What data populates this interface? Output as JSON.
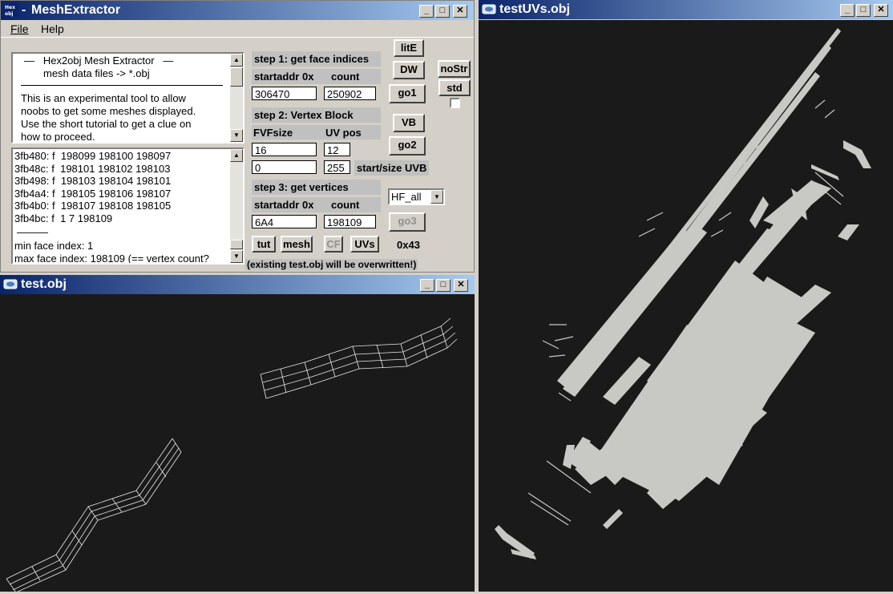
{
  "main_window": {
    "title": "MeshExtractor",
    "icon_text": "Hex\nobj -",
    "menu": [
      "File",
      "Help"
    ],
    "info_lines": [
      "—   Hex2obj Mesh Extractor   —",
      "mesh data files -> *.obj",
      "This is an experimental tool to allow",
      "noobs to get some meshes displayed.",
      "Use the short tutorial to get a clue on",
      "how to proceed."
    ],
    "log_lines": [
      "3fb480: f  198099 198100 198097",
      "3fb48c: f  198101 198102 198103",
      "3fb498: f  198103 198104 198101",
      "3fb4a4: f  198105 198106 198107",
      "3fb4b0: f  198107 198108 198105",
      "3fb4bc: f  1 7 198109",
      "———",
      "min face index: 1",
      "max face index: 198109 (== vertex count?"
    ],
    "step1": {
      "label": "step 1: get face indices",
      "startaddr_label": "startaddr 0x",
      "count_label": "count",
      "startaddr": "306470",
      "count": "250902"
    },
    "step2": {
      "label": "step 2: Vertex Block",
      "fvf_label": "FVFsize",
      "uvpos_label": "UV pos",
      "fvfsize": "16",
      "uvpos": "12",
      "uvb_start": "0",
      "uvb_size": "255",
      "uvb_label": "start/size UVB"
    },
    "step3": {
      "label": "step 3: get vertices",
      "startaddr_label": "startaddr 0x",
      "count_label": "count",
      "startaddr": "6A4",
      "count": "198109"
    },
    "buttons": {
      "lite": "litE",
      "dw": "DW",
      "go1": "go1",
      "vb": "VB",
      "go2": "go2",
      "go3": "go3",
      "nostr": "noStr",
      "std": "std",
      "tut": "tut",
      "mesh": "mesh",
      "cf": "CF",
      "uvs": "UVs"
    },
    "dropdown_value": "HF_all",
    "hex_readout": "0x43",
    "warning": "(existing test.obj will be overwritten!)"
  },
  "test_window": {
    "title": "test.obj"
  },
  "uv_window": {
    "title": "testUVs.obj"
  },
  "colors": {
    "title_start": "#0a246a",
    "title_end": "#a6caf0",
    "viewport": "#1a1a1a",
    "mesh_line": "#e8e8e8",
    "uv_fill": "#c8c8c4"
  }
}
